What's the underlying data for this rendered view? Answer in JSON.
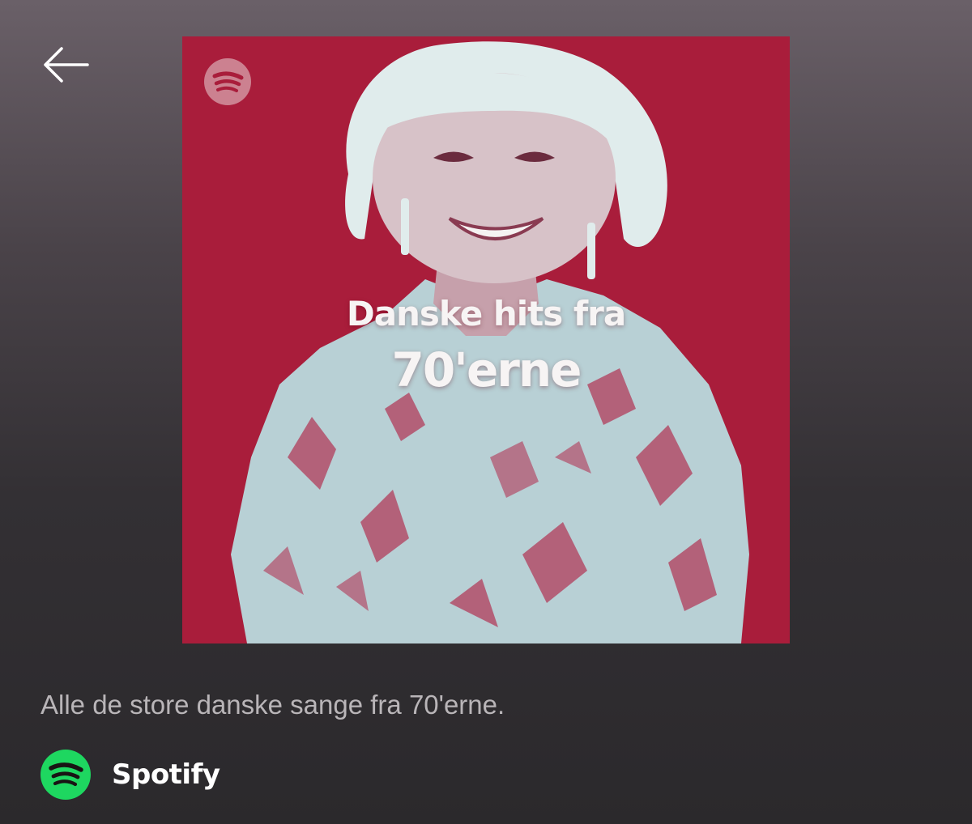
{
  "header": {
    "back_icon": "arrow-left-icon"
  },
  "cover": {
    "background_color": "#a91d3b",
    "tint_color": "#b8dadd",
    "logo_icon": "spotify-icon",
    "title_line1": "Danske hits fra",
    "title_line2": "70'erne"
  },
  "playlist": {
    "description": "Alle de store danske sange fra 70'erne.",
    "owner_name": "Spotify",
    "owner_icon": "spotify-icon",
    "brand_color": "#1ed760"
  }
}
